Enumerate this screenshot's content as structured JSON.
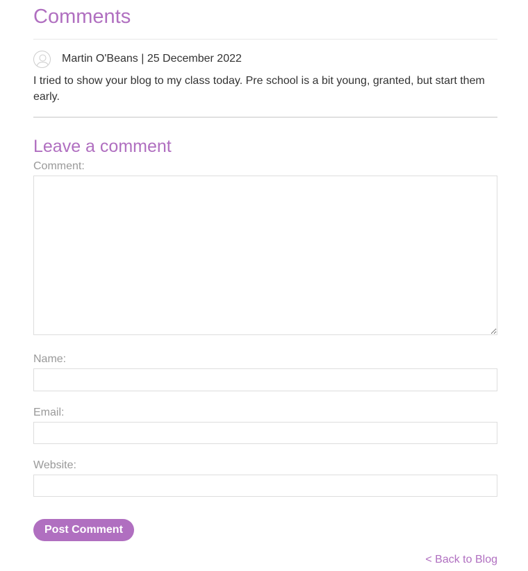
{
  "comments_section": {
    "title": "Comments",
    "items": [
      {
        "author": "Martin O'Beans",
        "date": "25 December 2022",
        "meta": "Martin O'Beans | 25 December 2022",
        "text": "I tried to show your blog to my class today. Pre school is a bit young, granted, but start them early.",
        "avatar_icon": "user-avatar-icon"
      }
    ]
  },
  "form": {
    "title": "Leave a comment",
    "comment_label": "Comment:",
    "comment_value": "",
    "name_label": "Name:",
    "name_value": "",
    "email_label": "Email:",
    "email_value": "",
    "website_label": "Website:",
    "website_value": "",
    "submit_label": "Post Comment"
  },
  "navigation": {
    "back_label": "< Back to Blog"
  },
  "colors": {
    "accent": "#b06fc0",
    "label": "#999999",
    "text": "#333333",
    "border": "#dddddd"
  }
}
